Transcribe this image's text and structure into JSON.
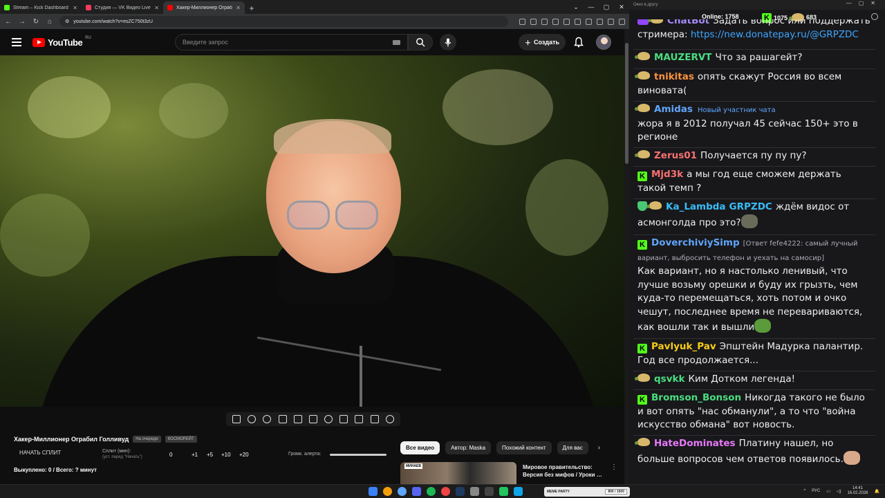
{
  "browser": {
    "tabs": [
      {
        "label": "Stream – Kick Dashboard",
        "color": "#53fc18"
      },
      {
        "label": "Студия — VK Видео Live",
        "color": "#ff3b5c"
      },
      {
        "label": "Хакер-Миллионер Ограбил Голливуд",
        "color": "#ff0000"
      }
    ],
    "new_tab": "+",
    "url": "youtube.com/watch?v=esZC750t3zU"
  },
  "youtube": {
    "logo_text": "YouTube",
    "logo_region": "RU",
    "search_placeholder": "Введите запрос",
    "create_label": "Создать"
  },
  "video_panel": {
    "title": "Хакер-Миллионер Ограбил Голливуд",
    "tag1": "На очереди",
    "tag2": "КОСМОРЕЙТ",
    "split_label": "НАЧАТЬ СПЛИТ",
    "split_min_label": "Сплит (мин):",
    "split_hint": "(уст. перед \"Начать\")",
    "split_value": "0",
    "steps": [
      "+1",
      "+5",
      "+10",
      "+20"
    ],
    "alert_volume_label": "Громк. алерта:",
    "bought": "Выкуплено: 0 / Всего: ? минут"
  },
  "recommendations": {
    "chips": [
      "Все видео",
      "Автор: Maska",
      "Похожий контент",
      "Для вас"
    ],
    "item_badge": "МИНАЕВ",
    "item_title": "Мировое правительство: Версия без мифов / Уроки …"
  },
  "chat": {
    "window_title": "Окно в другу",
    "online_label": "Online:",
    "online_value": "1758",
    "kick_count": "1075",
    "pp_count": "683",
    "messages": [
      {
        "user": "ChatBot",
        "color": "#a78bfa",
        "text": "Задать вопрос или поддержать стримера:",
        "link": "https://new.donatepay.ru/@GRPZDC"
      },
      {
        "user": "MAUZERVT",
        "color": "#4ade80",
        "text": "Что за рашагейт?"
      },
      {
        "user": "tnikitas",
        "color": "#fb923c",
        "text": "опять скажут Россия во всем виновата("
      },
      {
        "user": "Amidas",
        "color": "#60a5fa",
        "note": "Новый участник чата",
        "text": "жора я в 2012 получал 45 сейчас 150+ это в регионе"
      },
      {
        "user": "Zerus01",
        "color": "#f87171",
        "text": "Получается пу пу пу?"
      },
      {
        "user": "Mjd3k",
        "color": "#f87171",
        "text": "а мы год еще сможем держать такой темп ?"
      },
      {
        "user": "Ka_Lambda",
        "color": "#38bdf8",
        "mention": "GRPZDC",
        "text": "ждём видос от асмонголда про это?"
      },
      {
        "user": "DoverchiviySimp",
        "color": "#60a5fa",
        "reply": "[Ответ fefe4222: самый лучный вариант, выбросить телефон и уехать на самосир]",
        "text": "Как вариант, но я настолько ленивый, что лучше возьму орешки и буду их грызть, чем куда-то перемещаться, хоть потом и очко чешут, последнее время не перевариваются, как вошли так и вышли"
      },
      {
        "user": "Pavlyuk_Pav",
        "color": "#facc15",
        "text": "Эпштейн Мадурка палантир. Год все продолжается..."
      },
      {
        "user": "qsvkk",
        "color": "#4ade80",
        "text": "Ким Дотком легенда!"
      },
      {
        "user": "Bromson_Bonson",
        "color": "#4ade80",
        "text": "Никогда такого не было и вот опять \"нас обманули\", а то что \"война искусство обмана\" вот новость."
      },
      {
        "user": "HateDominates",
        "color": "#e879f9",
        "text": "Платину нашел, но больше вопросов чем ответов появилось."
      }
    ]
  },
  "taskbar": {
    "widget_label": "MEME PARTY",
    "widget_value": "800 / 1500",
    "lang": "РУС",
    "time": "14:41",
    "date": "16.02.2026"
  }
}
